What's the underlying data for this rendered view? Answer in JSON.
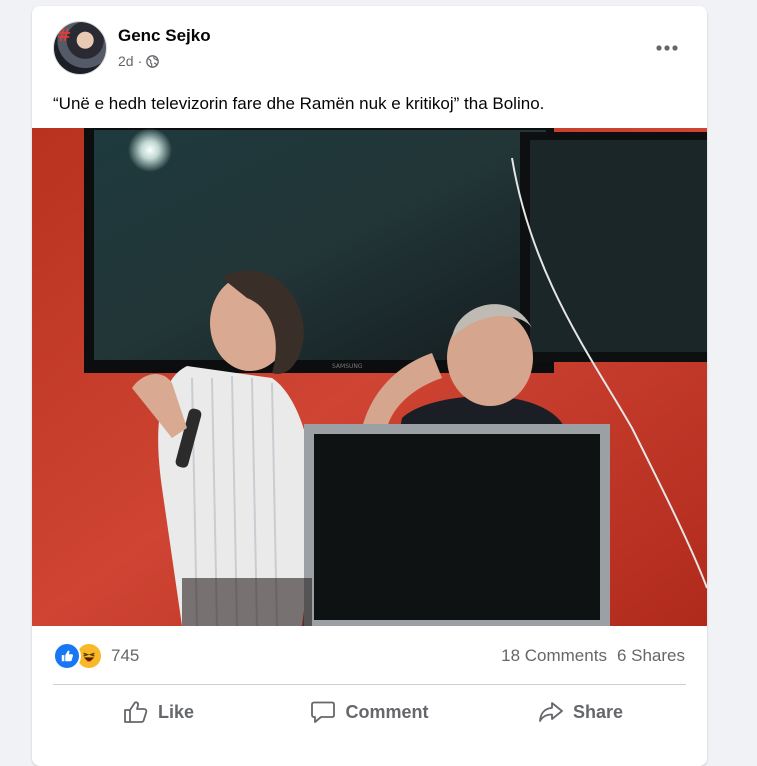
{
  "post": {
    "author": "Genc Sejko",
    "time": "2d",
    "audience_icon": "globe-icon",
    "caption": "“Unë e hedh televizorin fare dhe Ramën nuk e kritikoj” tha Bolino.",
    "avatar_badge": "#"
  },
  "photo": {
    "description_icon": "post-photo",
    "tv_brand": "SAMSUNG"
  },
  "reactions": {
    "types": [
      "like",
      "haha"
    ],
    "count": "745"
  },
  "stats": {
    "comments": "18 Comments",
    "shares": "6 Shares"
  },
  "actions": {
    "like": "Like",
    "comment": "Comment",
    "share": "Share"
  },
  "colors": {
    "page_bg": "#f0f2f5",
    "card_bg": "#ffffff",
    "text_primary": "#050505",
    "text_secondary": "#65676b",
    "like_blue": "#1877f2",
    "haha_yellow": "#f7b928",
    "wall_red": "#c23a2b"
  }
}
